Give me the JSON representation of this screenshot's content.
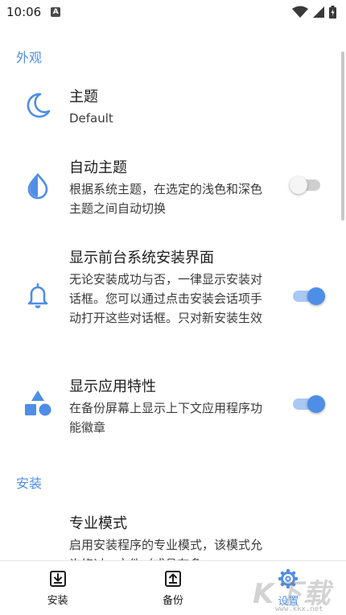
{
  "status_bar": {
    "time": "10:06",
    "notification_letter": "A"
  },
  "sections": {
    "appearance": {
      "header": "外观"
    },
    "install": {
      "header": "安装"
    }
  },
  "prefs": {
    "theme": {
      "title": "主题",
      "summary": "Default",
      "icon": "moon-icon"
    },
    "auto_theme": {
      "title": "自动主题",
      "summary": "根据系统主题，在选定的浅色和深色主题之间自动切换",
      "enabled": false,
      "icon": "water-drop-icon"
    },
    "show_foreground": {
      "title": "显示前台系统安装界面",
      "summary": "无论安装成功与否，一律显示安装对话框。您可以通过点击安装会话项手动打开这些对话框。只对新安装生效",
      "enabled": true,
      "icon": "bell-icon"
    },
    "show_features": {
      "title": "显示应用特性",
      "summary": "在备份屏幕上显示上下文应用程序功能徽章",
      "enabled": true,
      "icon": "shapes-icon"
    },
    "expert_mode": {
      "title": "专业模式",
      "summary": "启用安装程序的专业模式，该模式允许绕过...文件（或具有多"
    }
  },
  "bottom_nav": {
    "install": {
      "label": "安装",
      "icon": "download-box-icon"
    },
    "backup": {
      "label": "备份",
      "icon": "upload-box-icon"
    },
    "settings": {
      "label": "设置",
      "icon": "gear-icon",
      "active": true
    }
  },
  "watermark": {
    "text": "K下载",
    "url": "www.kkx.net"
  },
  "colors": {
    "accent": "#4f8ee6",
    "accent_track": "#a9c8f4",
    "text": "#1c1c1c"
  }
}
